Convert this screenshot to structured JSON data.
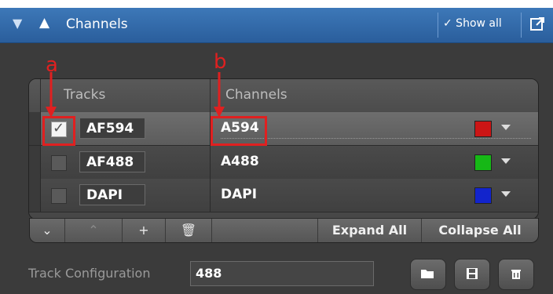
{
  "header": {
    "title": "Channels",
    "show_all_label": "✓ Show all"
  },
  "table": {
    "columns": [
      "Tracks",
      "Channels"
    ],
    "rows": [
      {
        "checked": true,
        "track": "AF594",
        "channel": "A594",
        "color": "#cc1515"
      },
      {
        "checked": false,
        "track": "AF488",
        "channel": "A488",
        "color": "#16b816"
      },
      {
        "checked": false,
        "track": "DAPI",
        "channel": "DAPI",
        "color": "#1224cc"
      }
    ],
    "footer": {
      "expand_all_label": "Expand All",
      "collapse_all_label": "Collapse All"
    }
  },
  "track_configuration": {
    "label": "Track Configuration",
    "value": "488"
  },
  "annotations": {
    "a": "a",
    "b": "b"
  },
  "icons": [
    "chevron-down-icon",
    "mountain-icon",
    "popout-icon",
    "plus-icon",
    "trash-icon",
    "folder-icon",
    "save-icon"
  ]
}
